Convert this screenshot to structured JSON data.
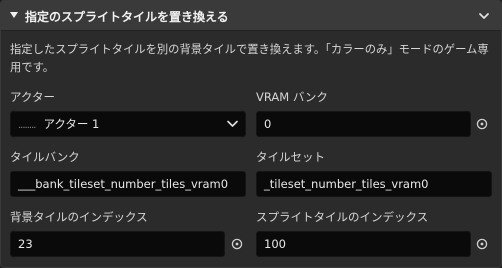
{
  "header": {
    "title": "指定のスプライトタイルを置き換える"
  },
  "description": "指定したスプライトタイルを別の背景タイルで置き換えます。「カラーのみ」モードのゲーム専用です。",
  "fields": {
    "actor": {
      "label": "アクター",
      "value": "アクター 1",
      "prefix": "........"
    },
    "vram_bank": {
      "label": "VRAM バンク",
      "value": "0"
    },
    "tile_bank": {
      "label": "タイルバンク",
      "value": "___bank_tileset_number_tiles_vram0"
    },
    "tileset": {
      "label": "タイルセット",
      "value": "_tileset_number_tiles_vram0"
    },
    "bg_tile_index": {
      "label": "背景タイルのインデックス",
      "value": "23"
    },
    "sprite_tile_index": {
      "label": "スプライトタイルのインデックス",
      "value": "100"
    }
  },
  "colors": {
    "header_bg": "#3a3a3a",
    "panel_bg": "#2b2b2b",
    "field_bg": "#0a0a0a"
  }
}
